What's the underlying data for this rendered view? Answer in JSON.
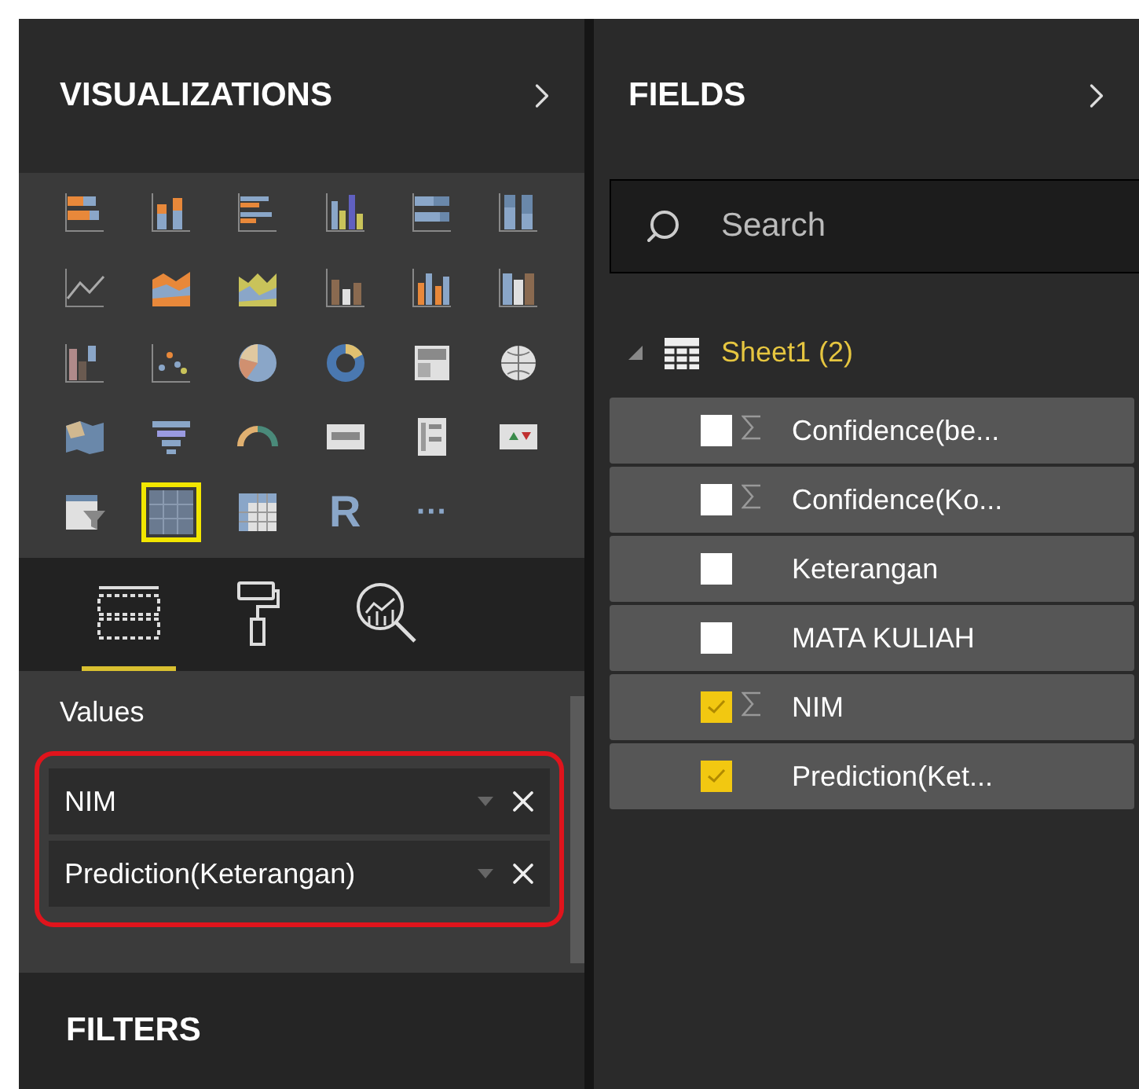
{
  "visualizations_pane": {
    "title": "VISUALIZATIONS",
    "visuals": [
      {
        "kind": "stacked-bar",
        "selected": false
      },
      {
        "kind": "stacked-column",
        "selected": false
      },
      {
        "kind": "clustered-bar",
        "selected": false
      },
      {
        "kind": "clustered-column",
        "selected": false
      },
      {
        "kind": "percent-bar",
        "selected": false
      },
      {
        "kind": "percent-column",
        "selected": false
      },
      {
        "kind": "line",
        "selected": false
      },
      {
        "kind": "area",
        "selected": false
      },
      {
        "kind": "stacked-area",
        "selected": false
      },
      {
        "kind": "line-column",
        "selected": false
      },
      {
        "kind": "line-clustered-column",
        "selected": false
      },
      {
        "kind": "ribbon",
        "selected": false
      },
      {
        "kind": "waterfall",
        "selected": false
      },
      {
        "kind": "scatter",
        "selected": false
      },
      {
        "kind": "pie",
        "selected": false
      },
      {
        "kind": "donut",
        "selected": false
      },
      {
        "kind": "treemap",
        "selected": false
      },
      {
        "kind": "globe",
        "selected": false
      },
      {
        "kind": "filled-map",
        "selected": false
      },
      {
        "kind": "funnel",
        "selected": false
      },
      {
        "kind": "gauge",
        "selected": false
      },
      {
        "kind": "card",
        "selected": false
      },
      {
        "kind": "multi-row-card",
        "selected": false
      },
      {
        "kind": "kpi",
        "selected": false
      },
      {
        "kind": "slicer",
        "selected": false
      },
      {
        "kind": "table",
        "selected": true
      },
      {
        "kind": "matrix",
        "selected": false
      },
      {
        "kind": "letter",
        "label": "R",
        "selected": false
      },
      {
        "kind": "letter",
        "label": "···",
        "selected": false
      }
    ],
    "tabs": [
      {
        "kind": "fields",
        "selected": true
      },
      {
        "kind": "format",
        "selected": false
      },
      {
        "kind": "analytics",
        "selected": false
      }
    ],
    "values_label": "Values",
    "values": [
      {
        "label": "NIM"
      },
      {
        "label": "Prediction(Keterangan)"
      }
    ],
    "filters_title": "FILTERS"
  },
  "fields_pane": {
    "title": "FIELDS",
    "search": {
      "placeholder": "Search"
    },
    "table": {
      "name": "Sheet1 (2)",
      "expanded": true,
      "fields": [
        {
          "name": "Confidence(be...",
          "sigma": true,
          "checked": false
        },
        {
          "name": "Confidence(Ko...",
          "sigma": true,
          "checked": false
        },
        {
          "name": "Keterangan",
          "sigma": false,
          "checked": false
        },
        {
          "name": "MATA KULIAH",
          "sigma": false,
          "checked": false
        },
        {
          "name": "NIM",
          "sigma": true,
          "checked": true
        },
        {
          "name": "Prediction(Ket...",
          "sigma": false,
          "checked": true
        }
      ]
    }
  }
}
